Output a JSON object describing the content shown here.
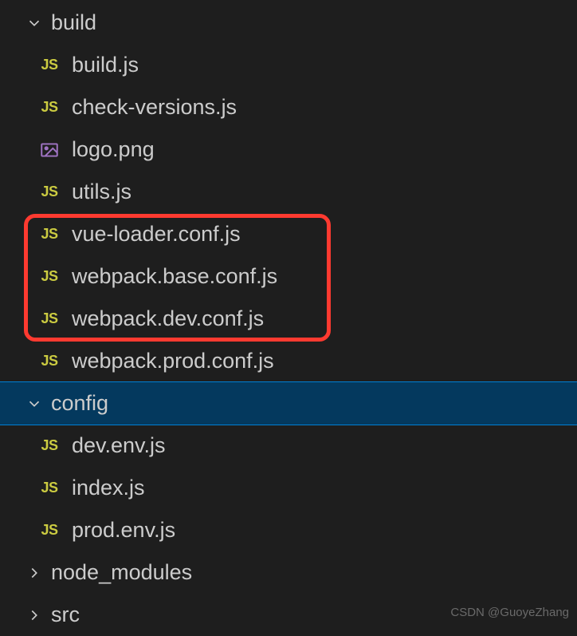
{
  "tree": {
    "folders": [
      {
        "name": "build",
        "expanded": true,
        "selected": false,
        "children": [
          {
            "name": "build.js",
            "icon": "js"
          },
          {
            "name": "check-versions.js",
            "icon": "js"
          },
          {
            "name": "logo.png",
            "icon": "image"
          },
          {
            "name": "utils.js",
            "icon": "js"
          },
          {
            "name": "vue-loader.conf.js",
            "icon": "js"
          },
          {
            "name": "webpack.base.conf.js",
            "icon": "js"
          },
          {
            "name": "webpack.dev.conf.js",
            "icon": "js"
          },
          {
            "name": "webpack.prod.conf.js",
            "icon": "js"
          }
        ]
      },
      {
        "name": "config",
        "expanded": true,
        "selected": true,
        "children": [
          {
            "name": "dev.env.js",
            "icon": "js"
          },
          {
            "name": "index.js",
            "icon": "js"
          },
          {
            "name": "prod.env.js",
            "icon": "js"
          }
        ]
      },
      {
        "name": "node_modules",
        "expanded": false,
        "selected": false,
        "children": []
      },
      {
        "name": "src",
        "expanded": false,
        "selected": false,
        "children": []
      }
    ]
  },
  "icons": {
    "js": "JS"
  },
  "watermark": "CSDN @GuoyeZhang"
}
